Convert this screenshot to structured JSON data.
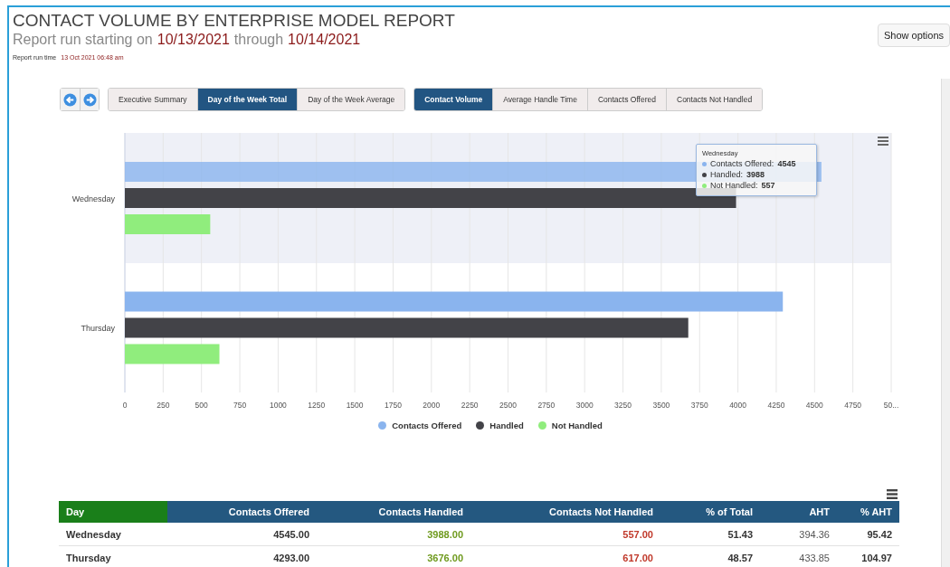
{
  "report": {
    "title": "CONTACT VOLUME BY ENTERPRISE MODEL REPORT",
    "subtitle_prefix": "Report run starting on",
    "start_date": "10/13/2021",
    "subtitle_middle": "through",
    "end_date": "10/14/2021",
    "run_time_label": "Report run time",
    "run_time": "13 Oct 2021 06:48 am"
  },
  "show_options": "Show options",
  "report_tabs": [
    {
      "label": "Executive Summary",
      "selected": false
    },
    {
      "label": "Day of the Week Total",
      "selected": true
    },
    {
      "label": "Day of the Week Average",
      "selected": false
    }
  ],
  "metric_tabs": [
    {
      "label": "Contact Volume",
      "selected": true
    },
    {
      "label": "Average Handle Time",
      "selected": false
    },
    {
      "label": "Contacts Offered",
      "selected": false
    },
    {
      "label": "Contacts Not Handled",
      "selected": false
    }
  ],
  "chart": {
    "hovered": [
      true,
      false
    ],
    "chart_data": {
      "type": "bar",
      "orientation": "horizontal",
      "categories": [
        "Wednesday",
        "Thursday"
      ],
      "series": [
        {
          "name": "Contacts Offered",
          "color": "#8ab4ee",
          "values": [
            4545,
            4293
          ]
        },
        {
          "name": "Handled",
          "color": "#434348",
          "values": [
            3988,
            3676
          ]
        },
        {
          "name": "Not Handled",
          "color": "#90ed7d",
          "values": [
            557,
            617
          ]
        }
      ],
      "xlim": [
        0,
        5000
      ],
      "grid": true,
      "legend": true,
      "xticks": [
        0,
        250,
        500,
        750,
        1000,
        1250,
        1500,
        1750,
        2000,
        2250,
        2500,
        2750,
        3000,
        3250,
        3500,
        3750,
        4000,
        4250,
        4500,
        4750,
        {
          "value": 5000,
          "label": "50..."
        }
      ]
    },
    "tooltip": {
      "title": "Wednesday",
      "rows": [
        {
          "label": "Contacts Offered:",
          "value": "4545",
          "color": "#8ab4ee"
        },
        {
          "label": "Handled:",
          "value": "3988",
          "color": "#434348"
        },
        {
          "label": "Not Handled:",
          "value": "557",
          "color": "#90ed7d"
        }
      ]
    }
  },
  "table": {
    "columns": [
      {
        "label": "Day",
        "color": "#1a7f1a"
      },
      {
        "label": "Contacts Offered",
        "color": "#245880"
      },
      {
        "label": "Contacts Handled",
        "color": "#245880"
      },
      {
        "label": "Contacts Not Handled",
        "color": "#245880"
      },
      {
        "label": "% of Total",
        "color": "#245880"
      },
      {
        "label": "AHT",
        "color": "#245880"
      },
      {
        "label": "% AHT",
        "color": "#245880"
      }
    ],
    "rows": [
      {
        "cells": [
          {
            "text": "Wednesday",
            "kind": "plain"
          },
          {
            "text": "4545.00",
            "kind": "plain"
          },
          {
            "text": "3988.00",
            "kind": "good"
          },
          {
            "text": "557.00",
            "kind": "bad"
          },
          {
            "text": "51.43",
            "kind": "plain"
          },
          {
            "text": "394.36",
            "kind": "muted"
          },
          {
            "text": "95.42",
            "kind": "plain"
          }
        ]
      },
      {
        "cells": [
          {
            "text": "Thursday",
            "kind": "plain"
          },
          {
            "text": "4293.00",
            "kind": "plain"
          },
          {
            "text": "3676.00",
            "kind": "good"
          },
          {
            "text": "617.00",
            "kind": "bad"
          },
          {
            "text": "48.57",
            "kind": "plain"
          },
          {
            "text": "433.85",
            "kind": "muted"
          },
          {
            "text": "104.97",
            "kind": "plain"
          }
        ]
      }
    ]
  }
}
